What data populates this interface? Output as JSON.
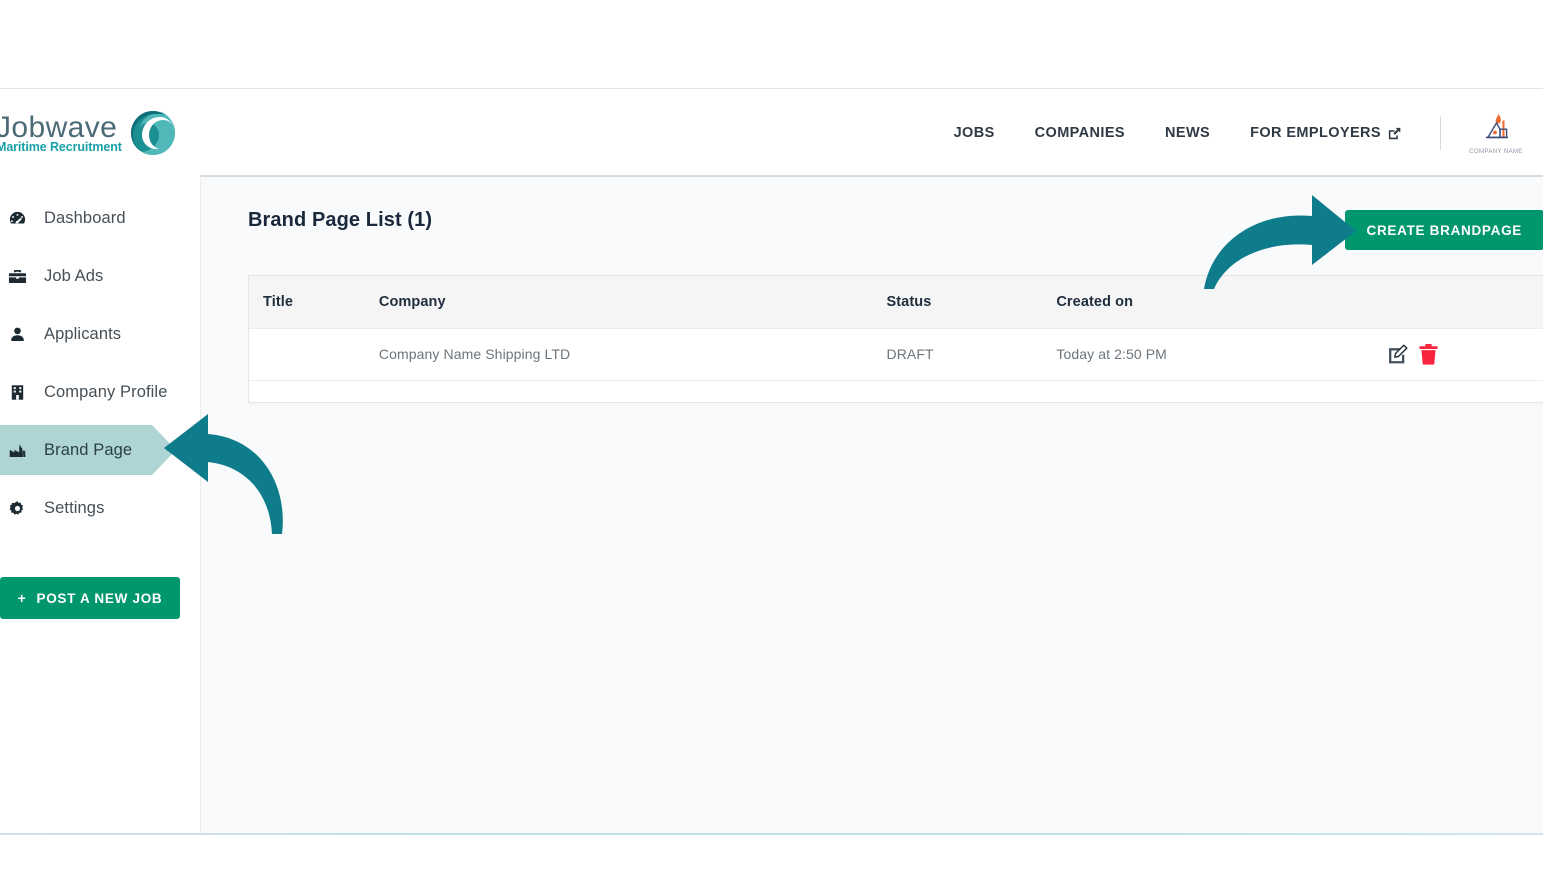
{
  "brand": {
    "logo_word": "Jobwave",
    "logo_tagline": "Maritime Recruitment",
    "logo_mark_icon": "wave-c-icon",
    "logo_primary_color": "#4c6b77",
    "logo_accent_color": "#1aa0a6"
  },
  "header": {
    "nav_items": [
      {
        "label": "JOBS",
        "icon": null
      },
      {
        "label": "COMPANIES",
        "icon": null
      },
      {
        "label": "NEWS",
        "icon": null
      },
      {
        "label": "FOR EMPLOYERS",
        "icon": "external-link-icon"
      }
    ],
    "account": {
      "logo_icon": "company-building-icon",
      "name": "COMPANY NAME"
    }
  },
  "sidebar": {
    "items": [
      {
        "label": "Dashboard",
        "icon": "dashboard-gauge-icon",
        "active": false
      },
      {
        "label": "Job Ads",
        "icon": "briefcase-icon",
        "active": false
      },
      {
        "label": "Applicants",
        "icon": "person-icon",
        "active": false
      },
      {
        "label": "Company Profile",
        "icon": "building-icon",
        "active": false
      },
      {
        "label": "Brand Page",
        "icon": "factory-icon",
        "active": true
      },
      {
        "label": "Settings",
        "icon": "gear-icon",
        "active": false
      }
    ],
    "post_job_button": {
      "label": "POST A NEW JOB",
      "plus": "+",
      "color": "#00966e"
    },
    "active_highlight_color": "#aed4d4"
  },
  "main": {
    "page_title": "Brand Page List (1)",
    "create_button": {
      "label": "CREATE BRANDPAGE",
      "color": "#00966e"
    },
    "table": {
      "columns": [
        "Title",
        "Company",
        "Status",
        "Created on",
        ""
      ],
      "rows": [
        {
          "title": "",
          "company": "Company Name Shipping LTD",
          "status": "DRAFT",
          "created_on": "Today at 2:50 PM",
          "actions": [
            "edit-icon",
            "delete-icon"
          ]
        }
      ]
    }
  },
  "annotations": [
    {
      "name": "arrow-to-create-brandpage",
      "icon": "curved-arrow-right-icon",
      "color": "#0f7c8c"
    },
    {
      "name": "arrow-to-brand-page-nav",
      "icon": "curved-arrow-left-icon",
      "color": "#0f7c8c"
    }
  ]
}
